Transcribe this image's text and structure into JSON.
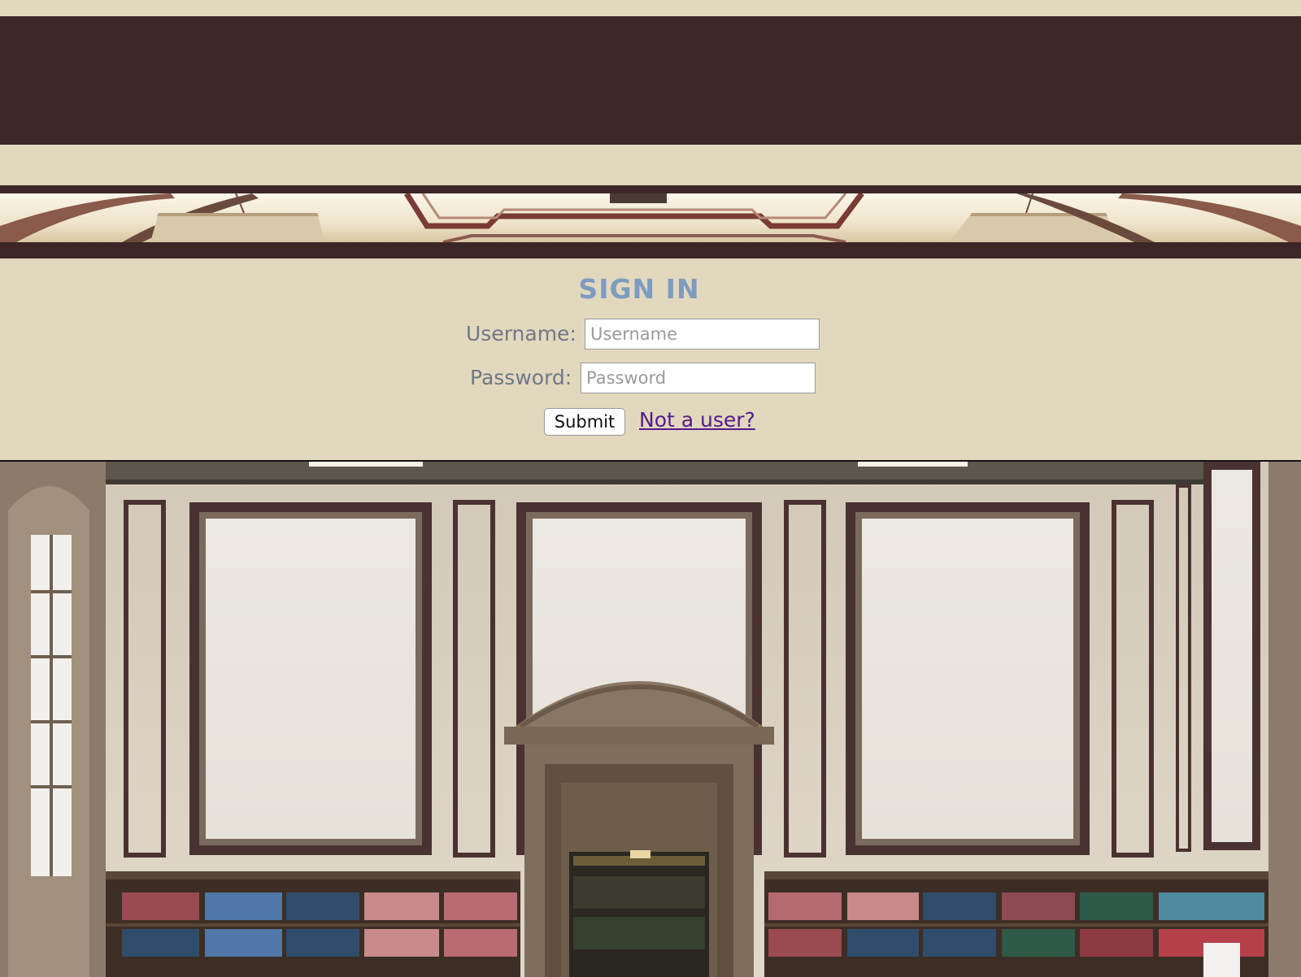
{
  "signin": {
    "title": "SIGN IN",
    "username_label": "Username:",
    "username_placeholder": "Username",
    "username_value": "",
    "password_label": "Password:",
    "password_placeholder": "Password",
    "password_value": "",
    "submit_label": "Submit",
    "register_link": "Not a user?"
  },
  "colors": {
    "background": "#e2d8bd",
    "header_band": "#3c2626",
    "title": "#7d9cc0",
    "label": "#6f7788",
    "link": "#551a8b"
  }
}
